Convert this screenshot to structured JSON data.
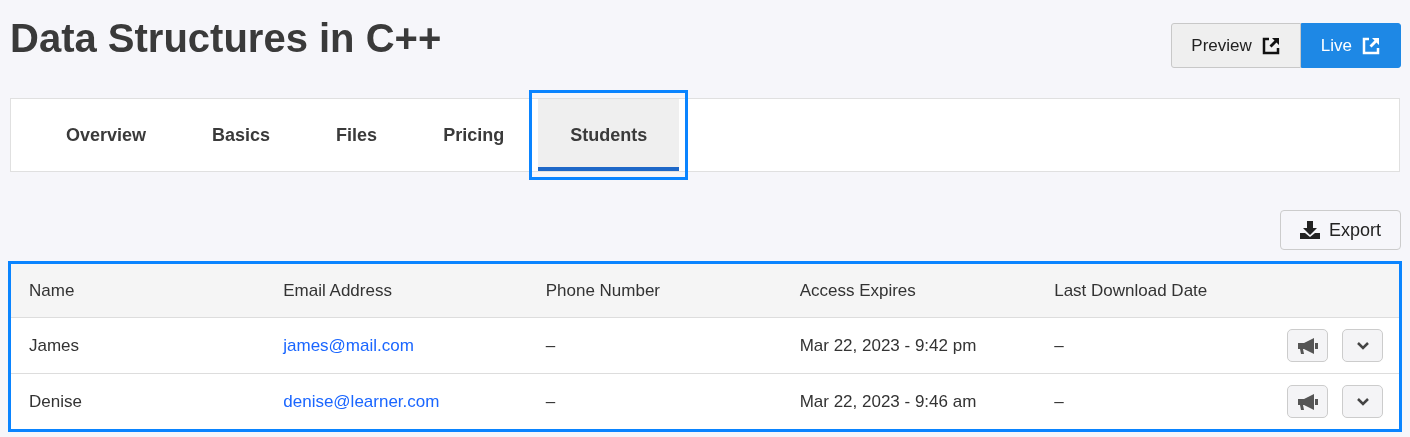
{
  "title": "Data Structures in C++",
  "header_buttons": [
    {
      "label": "Preview",
      "kind": "secondary"
    },
    {
      "label": "Live",
      "kind": "primary"
    }
  ],
  "tabs": [
    {
      "label": "Overview",
      "selected": false
    },
    {
      "label": "Basics",
      "selected": false
    },
    {
      "label": "Files",
      "selected": false
    },
    {
      "label": "Pricing",
      "selected": false
    },
    {
      "label": "Students",
      "selected": true
    }
  ],
  "export_button": {
    "label": "Export"
  },
  "table": {
    "columns": [
      "Name",
      "Email Address",
      "Phone Number",
      "Access Expires",
      "Last Download Date"
    ],
    "rows": [
      {
        "name": "James",
        "email": "james@mail.com",
        "phone": "–",
        "expires": "Mar 22, 2023 - 9:42 pm",
        "last_download": "–"
      },
      {
        "name": "Denise",
        "email": "denise@learner.com",
        "phone": "–",
        "expires": "Mar 22, 2023 - 9:46 am",
        "last_download": "–"
      }
    ]
  }
}
